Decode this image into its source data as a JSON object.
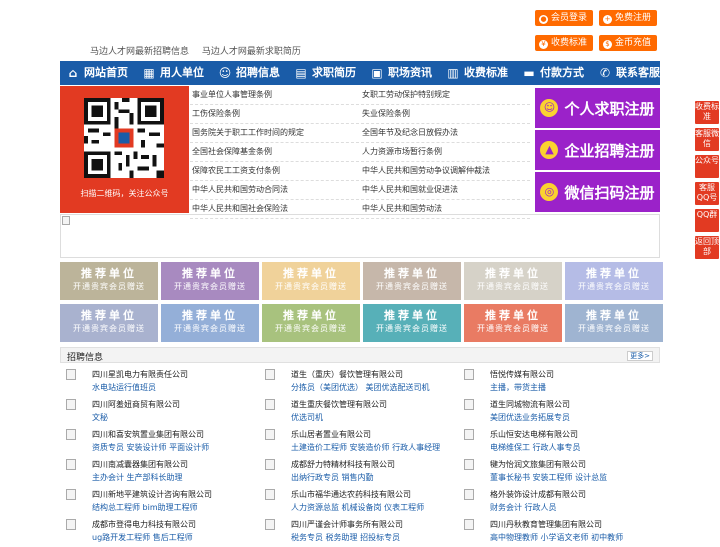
{
  "header": {
    "links": [
      "马边人才网最新招聘信息",
      "马边人才网最新求职简历"
    ],
    "buttons": [
      {
        "label": "会员登录",
        "icon": "user-icon"
      },
      {
        "label": "免费注册",
        "icon": "person-plus-icon"
      },
      {
        "label": "收费标准",
        "icon": "yen-icon"
      },
      {
        "label": "金币充值",
        "icon": "coin-icon"
      }
    ]
  },
  "nav": [
    {
      "label": "网站首页",
      "icon": "home-icon"
    },
    {
      "label": "用人单位",
      "icon": "building-icon"
    },
    {
      "label": "招聘信息",
      "icon": "people-icon"
    },
    {
      "label": "求职简历",
      "icon": "resume-icon"
    },
    {
      "label": "职场资讯",
      "icon": "news-icon"
    },
    {
      "label": "收费标准",
      "icon": "document-icon"
    },
    {
      "label": "付款方式",
      "icon": "wallet-icon"
    },
    {
      "label": "联系客服",
      "icon": "phone-icon"
    }
  ],
  "qr": {
    "caption": "扫描二维码，关注公众号"
  },
  "articles": [
    [
      "事业单位人事管理条例",
      "女职工劳动保护特别规定"
    ],
    [
      "工伤保险条例",
      "失业保险条例"
    ],
    [
      "国务院关于职工工作时间的规定",
      "全国年节及纪念日放假办法"
    ],
    [
      "全国社会保障基金条例",
      "人力资源市场暂行条例"
    ],
    [
      "保障农民工工资支付条例",
      "中华人民共和国劳动争议调解仲裁法"
    ],
    [
      "中华人民共和国劳动合同法",
      "中华人民共和国就业促进法"
    ],
    [
      "中华人民共和国社会保险法",
      "中华人民共和国劳动法"
    ]
  ],
  "register": [
    {
      "label": "个人求职注册",
      "icon": "person-icon"
    },
    {
      "label": "企业招聘注册",
      "icon": "enterprise-icon"
    },
    {
      "label": "微信扫码注册",
      "icon": "wechat-icon"
    }
  ],
  "float": [
    "收费标准",
    "客服微信",
    "公众号",
    "客服QQ号",
    "QQ群",
    "返回顶部"
  ],
  "ads": {
    "title": "推荐单位",
    "sub": "开通贵宾会员赠送",
    "colors": [
      "#bcb49a",
      "#a88ac0",
      "#f0d29a",
      "#c6b7aa",
      "#d6d2c8",
      "#b5bce6",
      "#a9b2cf",
      "#94afd8",
      "#a8c27e",
      "#57b0b8",
      "#e97b63",
      "#9fb4d1"
    ]
  },
  "jobs": {
    "title": "招聘信息",
    "more": "更多>",
    "items": [
      {
        "company": "四川星凯电力有限责任公司",
        "positions": "水电站运行值班员"
      },
      {
        "company": "道生（重庆）餐饮管理有限公司",
        "positions": "分拣员（美团优选） 美团优选配送司机"
      },
      {
        "company": "悟悦传媒有限公司",
        "positions": "主播，带货主播"
      },
      {
        "company": "四川阿羞妞商贸有限公司",
        "positions": "文秘"
      },
      {
        "company": "道生重庆餐饮管理有限公司",
        "positions": "优选司机"
      },
      {
        "company": "道生同城物流有限公司",
        "positions": "美团优选业务拓展专员"
      },
      {
        "company": "四川和喜安筑置业集团有限公司",
        "positions": "资质专员 安装设计师 平面设计师"
      },
      {
        "company": "乐山居者置业有限公司",
        "positions": "土建造价工程师 安装造价师 行政人事经理"
      },
      {
        "company": "乐山恒安达电梯有限公司",
        "positions": "电梯维保工 行政人事专员"
      },
      {
        "company": "四川南减囊器集团有限公司",
        "positions": "主办会计 生产部科长助理"
      },
      {
        "company": "成都舒力特精材科技有限公司",
        "positions": "出纳行政专员 销售内勤"
      },
      {
        "company": "犍为怡润文旅集团有限公司",
        "positions": "董事长秘书 安装工程师 设计总监"
      },
      {
        "company": "四川新地平建筑设计咨询有限公司",
        "positions": "结构总工程师 bim助理工程师"
      },
      {
        "company": "乐山市福华通达农药科技有限公司",
        "positions": "人力资源总监 机械设备岗 仪表工程师"
      },
      {
        "company": "格外装饰设计成都有限公司",
        "positions": "财务会计 行政人员"
      },
      {
        "company": "成都市登得电力科技有限公司",
        "positions": "ug路开发工程师 售后工程师"
      },
      {
        "company": "四川严谨会计师事务所有限公司",
        "positions": "税务专员 税务助理 招投标专员"
      },
      {
        "company": "四川丹秋教育管理集团有限公司",
        "positions": "高中物理教师 小学语文老师 初中教师"
      }
    ]
  }
}
